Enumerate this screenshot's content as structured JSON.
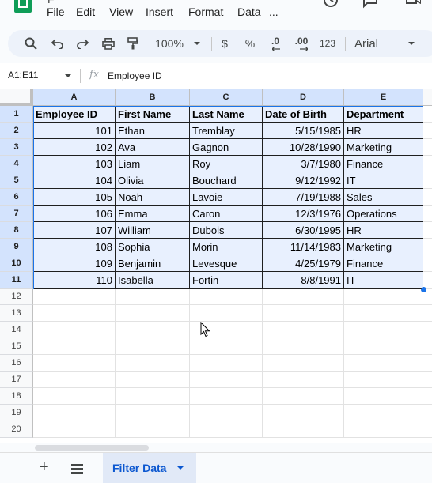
{
  "menu": {
    "title_fragment": "F",
    "items": [
      "File",
      "Edit",
      "View",
      "Insert",
      "Format",
      "Data",
      "..."
    ]
  },
  "toolbar": {
    "zoom": "100%",
    "currency": "$",
    "percent": "%",
    "decrease_decimal": ".0",
    "increase_decimal": ".00",
    "number_format": "123",
    "font": "Arial"
  },
  "formula_bar": {
    "name_box": "A1:E11",
    "fx": "fx",
    "value": "Employee ID"
  },
  "grid": {
    "columns": [
      "A",
      "B",
      "C",
      "D",
      "E"
    ],
    "row_numbers": [
      "1",
      "2",
      "3",
      "4",
      "5",
      "6",
      "7",
      "8",
      "9",
      "10",
      "11",
      "12",
      "13",
      "14",
      "15",
      "16",
      "17",
      "18",
      "19",
      "20"
    ],
    "rows": [
      [
        "Employee ID",
        "First Name",
        "Last Name",
        "Date of Birth",
        "Department"
      ],
      [
        "101",
        "Ethan",
        "Tremblay",
        "5/15/1985",
        "HR"
      ],
      [
        "102",
        "Ava",
        "Gagnon",
        "10/28/1990",
        "Marketing"
      ],
      [
        "103",
        "Liam",
        "Roy",
        "3/7/1980",
        "Finance"
      ],
      [
        "104",
        "Olivia",
        "Bouchard",
        "9/12/1992",
        "IT"
      ],
      [
        "105",
        "Noah",
        "Lavoie",
        "7/19/1988",
        "Sales"
      ],
      [
        "106",
        "Emma",
        "Caron",
        "12/3/1976",
        "Operations"
      ],
      [
        "107",
        "William",
        "Dubois",
        "6/30/1995",
        "HR"
      ],
      [
        "108",
        "Sophia",
        "Morin",
        "11/14/1983",
        "Marketing"
      ],
      [
        "109",
        "Benjamin",
        "Levesque",
        "4/25/1979",
        "Finance"
      ],
      [
        "110",
        "Isabella",
        "Fortin",
        "8/8/1991",
        "IT"
      ]
    ]
  },
  "sheets": {
    "active": "Filter Data"
  },
  "colors": {
    "selection": "#1a73e8",
    "selected_fill": "#e8f0fe",
    "header_selected": "#d3e3fd",
    "app_green": "#0f9d58",
    "tab_text": "#0b57d0"
  }
}
